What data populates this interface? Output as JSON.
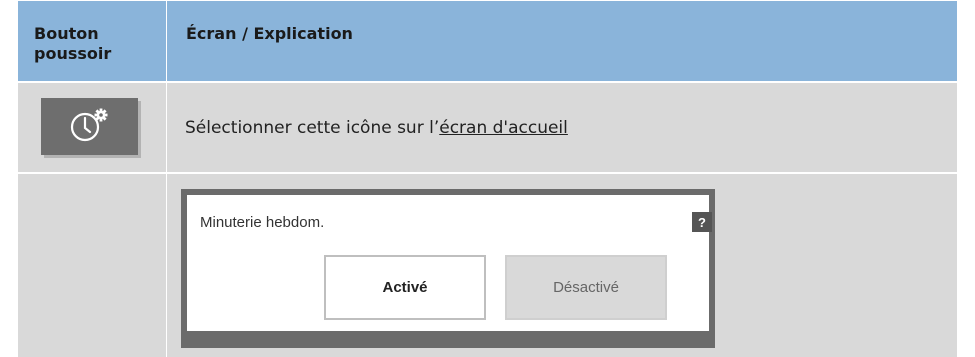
{
  "table": {
    "header": {
      "col1": "Bouton poussoir",
      "col2": "Écran / Explication"
    },
    "rows": [
      {
        "button_icon": "clock-settings-icon",
        "instruction_text": "Sélectionner cette icône sur l’",
        "instruction_link": "écran d'accueil"
      },
      {
        "screen": {
          "title": "Minuterie hebdom.",
          "help_label": "?",
          "option_on": "Activé",
          "option_off": "Désactivé"
        }
      }
    ]
  },
  "colors": {
    "header_bg": "#8ab4da",
    "row_bg": "#d9d9d9",
    "button_bg": "#6e6e6e",
    "screen_frame": "#6b6b6b"
  }
}
